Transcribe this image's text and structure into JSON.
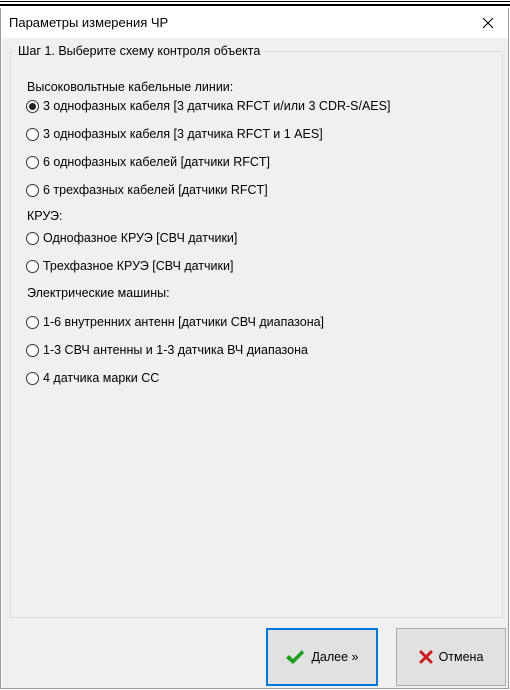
{
  "window": {
    "title": "Параметры измерения ЧР"
  },
  "group": {
    "legend": "Шаг 1. Выберите схему контроля объекта"
  },
  "sections": [
    {
      "label": "Высоковольтные кабельные линии:",
      "options": [
        {
          "label": "3 однофазных кабеля [3 датчика RFCT и/или 3 CDR-S/AES]",
          "checked": true
        },
        {
          "label": "3 однофазных кабеля [3 датчика RFCT и 1 AES]",
          "checked": false
        },
        {
          "label": "6 однофазных кабелей [датчики RFCT]",
          "checked": false
        },
        {
          "label": "6 трехфазных кабелей [датчики RFCT]",
          "checked": false
        }
      ]
    },
    {
      "label": "КРУЭ:",
      "options": [
        {
          "label": "Однофазное КРУЭ [СВЧ датчики]",
          "checked": false
        },
        {
          "label": "Трехфазное КРУЭ [СВЧ датчики]",
          "checked": false
        }
      ]
    },
    {
      "label": "Электрические машины:",
      "options": [
        {
          "label": "1-6 внутренних антенн [датчики СВЧ диапазона]",
          "checked": false
        },
        {
          "label": "1-3 СВЧ антенны и 1-3 датчика ВЧ диапазона",
          "checked": false
        },
        {
          "label": "4 датчика марки СС",
          "checked": false
        }
      ]
    }
  ],
  "buttons": {
    "next_label": "Далее »",
    "cancel_label": "Отмена"
  },
  "icons": {
    "close": "close-icon",
    "next": "checkmark-icon",
    "cancel": "cross-icon"
  },
  "colors": {
    "accent": "#0078d7",
    "check_green": "#1e9e1e",
    "cancel_red": "#c81e1e"
  }
}
